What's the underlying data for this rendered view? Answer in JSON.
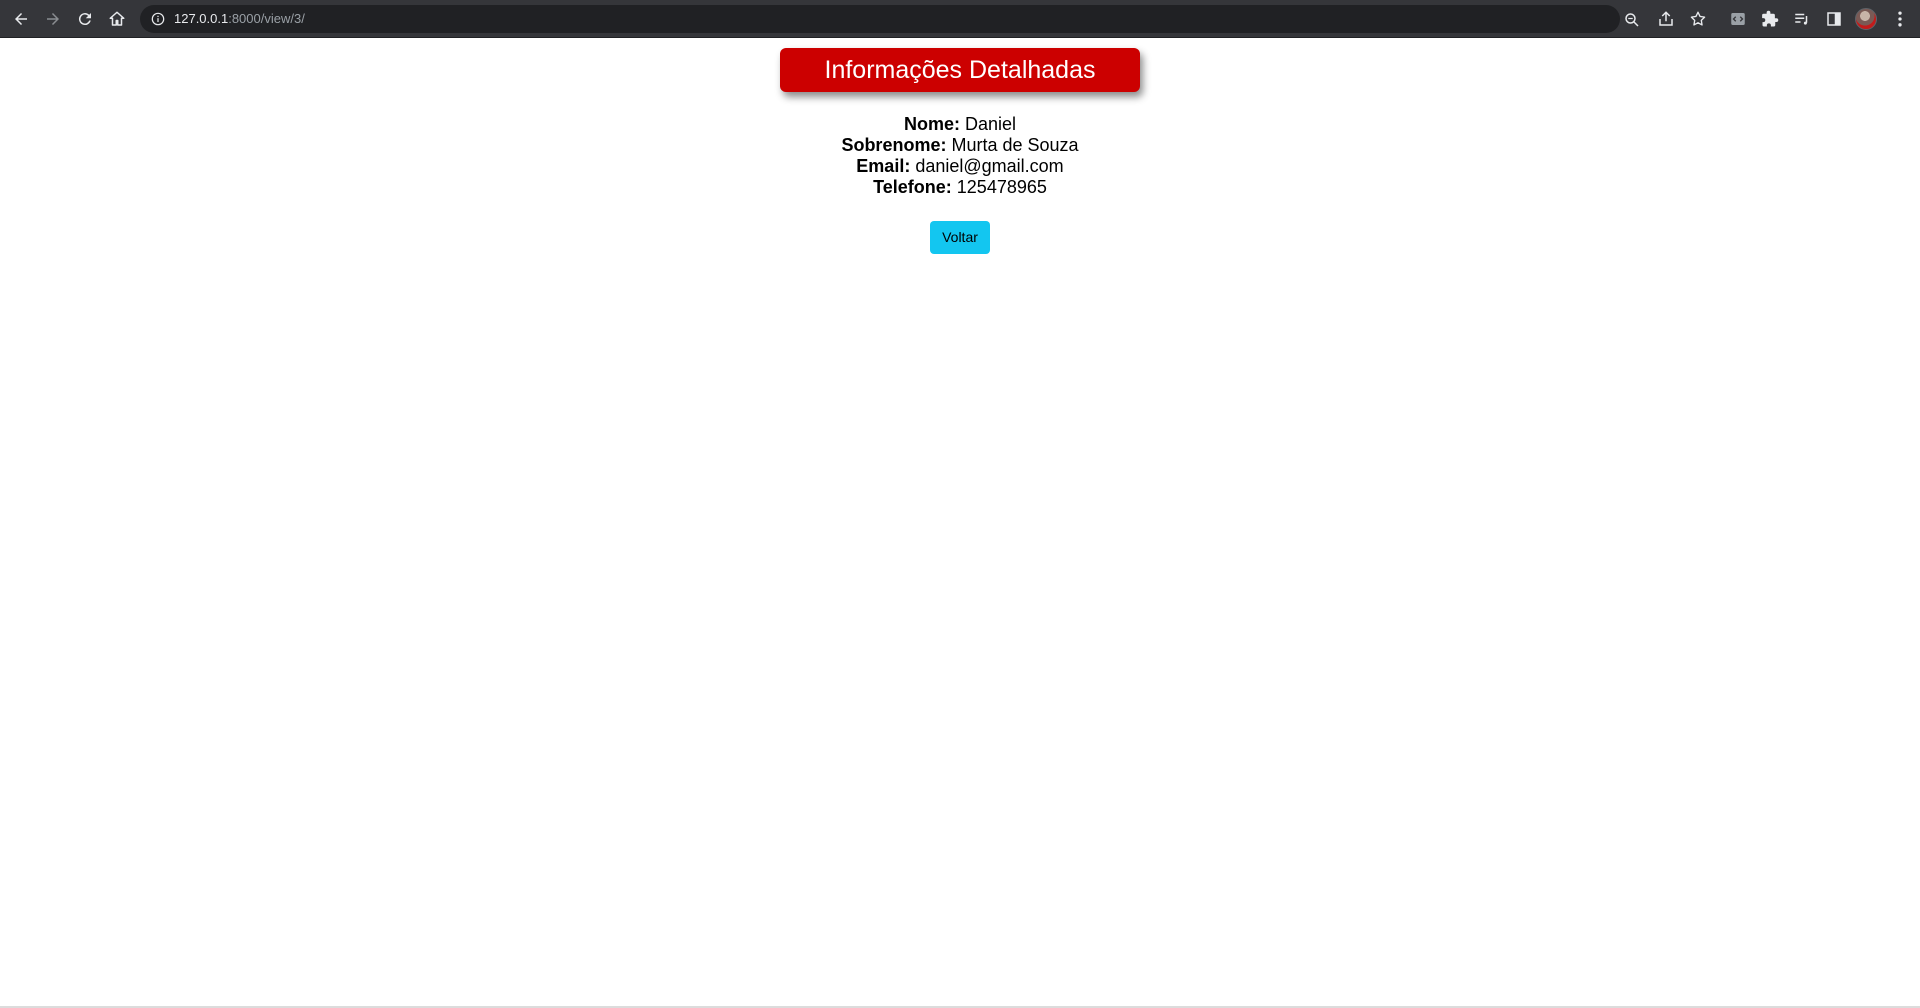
{
  "browser": {
    "url_host": "127.0.0.1",
    "url_path": ":8000/view/3/",
    "icons": {
      "back": "back-arrow-icon",
      "forward": "forward-arrow-icon",
      "reload": "reload-icon",
      "home": "home-icon",
      "site_info": "info-icon",
      "zoom": "zoom-icon",
      "share": "share-icon",
      "bookmark": "star-icon",
      "extension_1": "code-extension-icon",
      "extensions": "puzzle-icon",
      "reading_list": "reading-list-icon",
      "side_panel": "side-panel-icon",
      "profile": "avatar",
      "menu": "kebab-menu-icon"
    }
  },
  "page": {
    "title": "Informações Detalhadas",
    "fields": [
      {
        "label": "Nome:",
        "value": "Daniel"
      },
      {
        "label": "Sobrenome:",
        "value": "Murta de Souza"
      },
      {
        "label": "Email:",
        "value": "daniel@gmail.com"
      },
      {
        "label": "Telefone:",
        "value": "125478965"
      }
    ],
    "back_button": "Voltar"
  },
  "colors": {
    "title_bg": "#cc0000",
    "button_bg": "#13c6f0",
    "chrome_bg": "#35363a",
    "omnibox_bg": "#202124"
  }
}
